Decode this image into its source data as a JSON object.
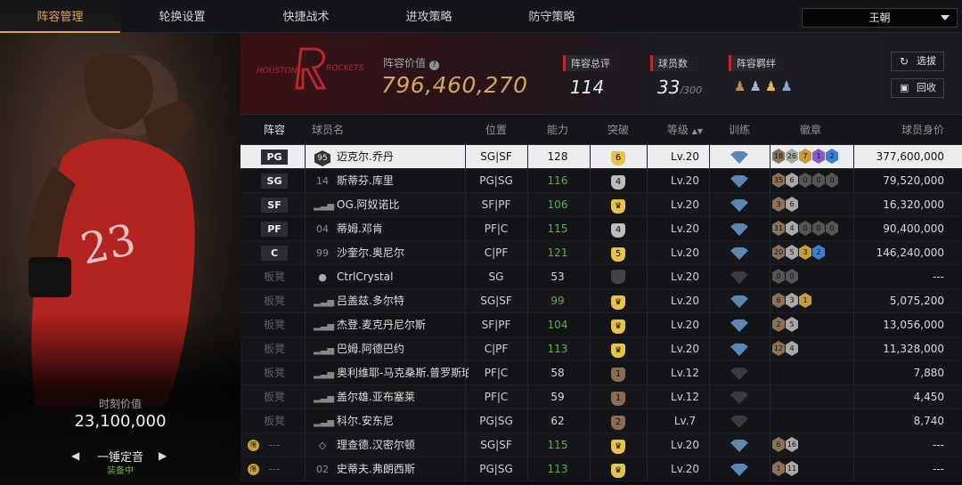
{
  "tabs": [
    "阵容管理",
    "轮换设置",
    "快捷战术",
    "进攻策略",
    "防守策略"
  ],
  "team_select": "王朝",
  "left": {
    "moment_label": "时刻价值",
    "moment_value": "23,100,000",
    "card_name": "一锤定音",
    "card_status": "装备中"
  },
  "header": {
    "value_label": "阵容价值",
    "value": "796,460,270",
    "rating_label": "阵容总评",
    "rating": "114",
    "players_label": "球员数",
    "players": "33",
    "players_max": "/300",
    "bond_label": "阵容羁绊",
    "btn_pick": "选拔",
    "btn_recycle": "回收"
  },
  "columns": [
    "阵容",
    "球员名",
    "位置",
    "能力",
    "突破",
    "等级",
    "训练",
    "徽章",
    "球员身价"
  ],
  "colors": {
    "accent": "#e3a44b",
    "green": "#5fae4b",
    "red": "#c0262d",
    "train_blue": "#5d87b3"
  },
  "rows": [
    {
      "slot": "PG",
      "starter": true,
      "num": "95",
      "name": "迈克尔.乔丹",
      "pos": "SG|SF",
      "ability": "128",
      "green": false,
      "breakthrough": "6",
      "bcolor": "#e8c24a",
      "level": "Lv.20",
      "badges": [
        [
          "18",
          "#8a7257"
        ],
        [
          "26",
          "#a8a8a8"
        ],
        [
          "7",
          "#c79a3b"
        ],
        [
          "1",
          "#8b58c6"
        ],
        [
          "2",
          "#3a7fd0"
        ]
      ],
      "price": "377,600,000"
    },
    {
      "slot": "SG",
      "starter": true,
      "num": "14",
      "name": "斯蒂芬.库里",
      "pos": "PG|SG",
      "ability": "116",
      "green": true,
      "breakthrough": "4",
      "bcolor": "#bdbdbd",
      "level": "Lv.20",
      "badges": [
        [
          "35",
          "#8a7257"
        ],
        [
          "6",
          "#a8a8a8"
        ],
        [
          "0",
          "#555"
        ],
        [
          "0",
          "#555"
        ],
        [
          "0",
          "#555"
        ]
      ],
      "price": "79,520,000"
    },
    {
      "slot": "SF",
      "starter": true,
      "num": "",
      "name": "OG.阿奴诺比",
      "pos": "SF|PF",
      "ability": "106",
      "green": true,
      "breakthrough": "",
      "bcolor": "#e8c24a",
      "level": "Lv.20",
      "badges": [
        [
          "3",
          "#8a7257"
        ],
        [
          "6",
          "#a8a8a8"
        ]
      ],
      "price": "16,320,000"
    },
    {
      "slot": "PF",
      "starter": true,
      "num": "04",
      "name": "蒂姆.邓肯",
      "pos": "PF|C",
      "ability": "115",
      "green": true,
      "breakthrough": "4",
      "bcolor": "#bdbdbd",
      "level": "Lv.20",
      "badges": [
        [
          "31",
          "#8a7257"
        ],
        [
          "4",
          "#a8a8a8"
        ],
        [
          "0",
          "#555"
        ],
        [
          "0",
          "#555"
        ],
        [
          "0",
          "#555"
        ]
      ],
      "price": "90,400,000"
    },
    {
      "slot": "C",
      "starter": true,
      "num": "99",
      "name": "沙奎尔.奥尼尔",
      "pos": "C|PF",
      "ability": "121",
      "green": true,
      "breakthrough": "5",
      "bcolor": "#e8c24a",
      "level": "Lv.20",
      "badges": [
        [
          "20",
          "#8a7257"
        ],
        [
          "5",
          "#a8a8a8"
        ],
        [
          "3",
          "#c79a3b"
        ],
        [
          "2",
          "#3a7fd0"
        ]
      ],
      "price": "146,240,000"
    },
    {
      "slot": "板凳",
      "starter": false,
      "num": "",
      "name": "CtrlCrystal",
      "pos": "SG",
      "ability": "53",
      "green": false,
      "breakthrough": "",
      "bcolor": "#444",
      "level": "Lv.20",
      "badges": [
        [
          "0",
          "#555"
        ],
        [
          "0",
          "#555"
        ]
      ],
      "price": "---"
    },
    {
      "slot": "板凳",
      "starter": false,
      "num": "",
      "name": "吕盖兹.多尔特",
      "pos": "SG|SF",
      "ability": "99",
      "green": true,
      "breakthrough": "",
      "bcolor": "#e8c24a",
      "level": "Lv.20",
      "badges": [
        [
          "6",
          "#8a7257"
        ],
        [
          "3",
          "#a8a8a8"
        ],
        [
          "1",
          "#c79a3b"
        ]
      ],
      "price": "5,075,200"
    },
    {
      "slot": "板凳",
      "starter": false,
      "num": "",
      "name": "杰登.麦克丹尼尔斯",
      "pos": "SF|PF",
      "ability": "104",
      "green": true,
      "breakthrough": "",
      "bcolor": "#e8c24a",
      "level": "Lv.20",
      "badges": [
        [
          "2",
          "#8a7257"
        ],
        [
          "5",
          "#a8a8a8"
        ]
      ],
      "price": "13,056,000"
    },
    {
      "slot": "板凳",
      "starter": false,
      "num": "",
      "name": "巴姆.阿德巴约",
      "pos": "C|PF",
      "ability": "113",
      "green": true,
      "breakthrough": "",
      "bcolor": "#e8c24a",
      "level": "Lv.20",
      "badges": [
        [
          "12",
          "#8a7257"
        ],
        [
          "4",
          "#a8a8a8"
        ]
      ],
      "price": "11,328,000"
    },
    {
      "slot": "板凳",
      "starter": false,
      "num": "",
      "name": "奥利维耶-马克桑斯.普罗斯珀",
      "pos": "PF|C",
      "ability": "58",
      "green": false,
      "breakthrough": "1",
      "bcolor": "#8b6a52",
      "level": "Lv.12",
      "badges": [],
      "price": "7,880"
    },
    {
      "slot": "板凳",
      "starter": false,
      "num": "",
      "name": "盖尔雄.亚布塞莱",
      "pos": "PF|C",
      "ability": "59",
      "green": false,
      "breakthrough": "1",
      "bcolor": "#8b6a52",
      "level": "Lv.12",
      "badges": [],
      "price": "4,450"
    },
    {
      "slot": "板凳",
      "starter": false,
      "num": "",
      "name": "科尔.安东尼",
      "pos": "PG|SG",
      "ability": "62",
      "green": false,
      "breakthrough": "2",
      "bcolor": "#8b6a52",
      "level": "Lv.7",
      "badges": [],
      "price": "8,740"
    },
    {
      "slot": "---",
      "starter": false,
      "num": "",
      "name": "理查德.汉密尔顿",
      "pos": "SG|SF",
      "ability": "115",
      "green": true,
      "breakthrough": "",
      "bcolor": "#e8c24a",
      "level": "Lv.20",
      "badges": [
        [
          "6",
          "#8a7257"
        ],
        [
          "16",
          "#a8a8a8"
        ]
      ],
      "price": "---"
    },
    {
      "slot": "---",
      "starter": false,
      "num": "02",
      "name": "史蒂夫.弗朗西斯",
      "pos": "PG|SG",
      "ability": "113",
      "green": true,
      "breakthrough": "",
      "bcolor": "#e8c24a",
      "level": "Lv.20",
      "badges": [
        [
          "1",
          "#8a7257"
        ],
        [
          "11",
          "#a8a8a8"
        ]
      ],
      "price": "---"
    }
  ]
}
